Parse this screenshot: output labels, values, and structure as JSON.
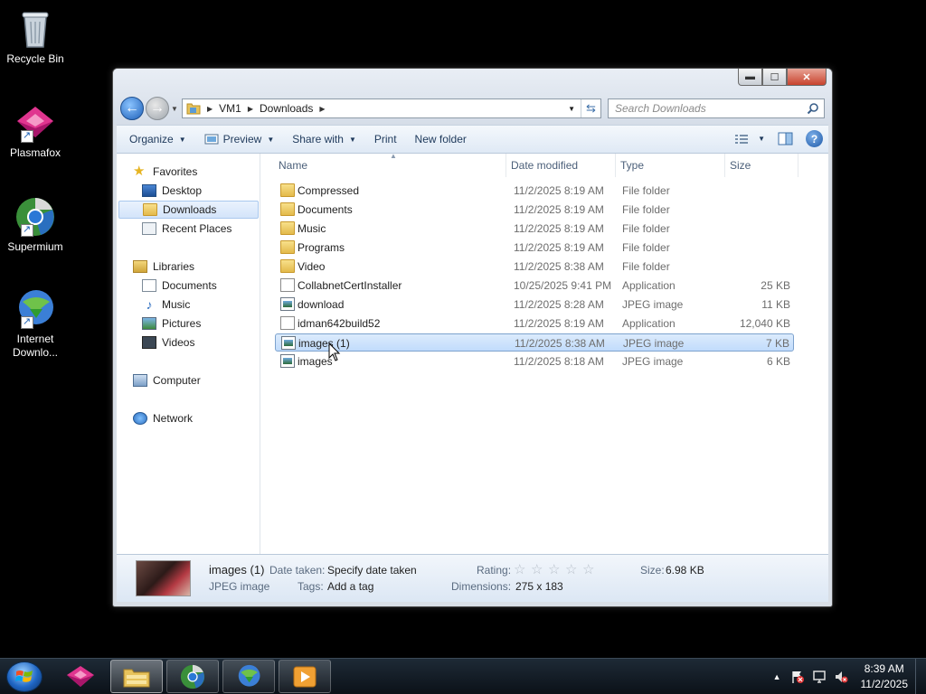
{
  "desktop": {
    "icons": [
      {
        "label": "Recycle Bin",
        "icon": "recycle-bin-icon"
      },
      {
        "label": "Plasmafox",
        "icon": "plasmafox-icon"
      },
      {
        "label": "Supermium",
        "icon": "supermium-icon"
      },
      {
        "label_line1": "Internet",
        "label_line2": "Downlo...",
        "icon": "internet-download-manager-icon"
      }
    ]
  },
  "window": {
    "buttons": {
      "minimize": "▬",
      "maximize": "☐",
      "close": "✕"
    },
    "address": {
      "crumbs": [
        "VM1",
        "Downloads"
      ]
    },
    "search": {
      "placeholder": "Search Downloads"
    },
    "toolbar": {
      "organize": "Organize",
      "preview": "Preview",
      "share_with": "Share with",
      "print": "Print",
      "new_folder": "New folder"
    },
    "nav": {
      "favorites": "Favorites",
      "desktop": "Desktop",
      "downloads": "Downloads",
      "recent_places": "Recent Places",
      "libraries": "Libraries",
      "documents": "Documents",
      "music": "Music",
      "pictures": "Pictures",
      "videos": "Videos",
      "computer": "Computer",
      "network": "Network"
    },
    "columns": {
      "name": "Name",
      "date": "Date modified",
      "type": "Type",
      "size": "Size"
    },
    "files": [
      {
        "name": "Compressed",
        "date": "11/2/2025 8:19 AM",
        "type": "File folder",
        "size": "",
        "kind": "folder"
      },
      {
        "name": "Documents",
        "date": "11/2/2025 8:19 AM",
        "type": "File folder",
        "size": "",
        "kind": "folder"
      },
      {
        "name": "Music",
        "date": "11/2/2025 8:19 AM",
        "type": "File folder",
        "size": "",
        "kind": "folder"
      },
      {
        "name": "Programs",
        "date": "11/2/2025 8:19 AM",
        "type": "File folder",
        "size": "",
        "kind": "folder"
      },
      {
        "name": "Video",
        "date": "11/2/2025 8:38 AM",
        "type": "File folder",
        "size": "",
        "kind": "folder"
      },
      {
        "name": "CollabnetCertInstaller",
        "date": "10/25/2025 9:41 PM",
        "type": "Application",
        "size": "25 KB",
        "kind": "app"
      },
      {
        "name": "download",
        "date": "11/2/2025 8:28 AM",
        "type": "JPEG image",
        "size": "11 KB",
        "kind": "jpeg"
      },
      {
        "name": "idman642build52",
        "date": "11/2/2025 8:19 AM",
        "type": "Application",
        "size": "12,040 KB",
        "kind": "app"
      },
      {
        "name": "images (1)",
        "date": "11/2/2025 8:38 AM",
        "type": "JPEG image",
        "size": "7 KB",
        "kind": "jpeg",
        "selected": true
      },
      {
        "name": "images",
        "date": "11/2/2025 8:18 AM",
        "type": "JPEG image",
        "size": "6 KB",
        "kind": "jpeg"
      }
    ],
    "details": {
      "filename": "images (1)",
      "filetype": "JPEG image",
      "date_taken_label": "Date taken:",
      "date_taken_value": "Specify date taken",
      "tags_label": "Tags:",
      "tags_value": "Add a tag",
      "rating_label": "Rating:",
      "rating_value": 0,
      "dimensions_label": "Dimensions:",
      "dimensions_value": "275 x 183",
      "size_label": "Size:",
      "size_value": "6.98 KB"
    }
  },
  "taskbar": {
    "apps": [
      "plasmafox-icon",
      "windows-explorer-icon",
      "supermium-icon",
      "internet-download-manager-icon",
      "media-player-icon"
    ],
    "clock": {
      "time": "8:39 AM",
      "date": "11/2/2025"
    }
  },
  "colors": {
    "selection": "#c1dcfc",
    "toolbar_text": "#1e395b",
    "desktop": "#000000"
  }
}
